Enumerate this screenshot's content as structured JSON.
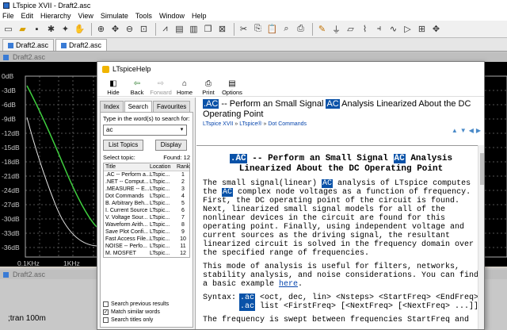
{
  "app": {
    "title": "LTspice XVII - Draft2.asc",
    "menu": [
      "File",
      "Edit",
      "Hierarchy",
      "View",
      "Simulate",
      "Tools",
      "Window",
      "Help"
    ],
    "tabs": [
      "Draft2.asc",
      "Draft2.asc"
    ]
  },
  "plot": {
    "window_title": "Draft2.asc",
    "y_ticks": [
      "0dB",
      "-3dB",
      "-6dB",
      "-9dB",
      "-12dB",
      "-15dB",
      "-18dB",
      "-21dB",
      "-24dB",
      "-27dB",
      "-30dB",
      "-33dB",
      "-36dB"
    ],
    "x_ticks": [
      "0.1KHz",
      "1KHz"
    ]
  },
  "schematic": {
    "window_title": "Draft2.asc",
    "directive": ";tran 100m"
  },
  "help": {
    "window_title": "LTspiceHelp",
    "toolbar": [
      "Hide",
      "Back",
      "Forward",
      "Home",
      "Print",
      "Options"
    ],
    "nav_tabs": [
      "Index",
      "Search",
      "Favourites"
    ],
    "search_label": "Type in the word(s) to search for:",
    "search_value": "ac",
    "list_topics_label": "List Topics",
    "display_label": "Display",
    "select_topic_label": "Select topic:",
    "found_label": "Found: 12",
    "results_headers": [
      "Title",
      "Location",
      "Rank"
    ],
    "results": [
      {
        "title": ".AC -- Perform a...",
        "location": "LTspic...",
        "rank": "1"
      },
      {
        "title": ".NET -- Comput...",
        "location": "LTspic...",
        "rank": "2"
      },
      {
        "title": ".MEASURE -- E...",
        "location": "LTspic...",
        "rank": "3"
      },
      {
        "title": "Dot Commands",
        "location": "LTspic...",
        "rank": "4"
      },
      {
        "title": "B. Arbitrary Beh...",
        "location": "LTspic...",
        "rank": "5"
      },
      {
        "title": "I. Current Source",
        "location": "LTspic...",
        "rank": "6"
      },
      {
        "title": "V. Voltage Sour...",
        "location": "LTspic...",
        "rank": "7"
      },
      {
        "title": "Waveform Arith...",
        "location": "LTspic...",
        "rank": "8"
      },
      {
        "title": "Save Plot Confi...",
        "location": "LTspic...",
        "rank": "9"
      },
      {
        "title": "Fast Access File...",
        "location": "LTspic...",
        "rank": "10"
      },
      {
        "title": "NOISE -- Perfo...",
        "location": "LTspic...",
        "rank": "11"
      },
      {
        "title": "M. MOSFET",
        "location": "LTspic...",
        "rank": "12"
      }
    ],
    "checkboxes": [
      {
        "label": "Search previous results",
        "checked": false
      },
      {
        "label": "Match similar words",
        "checked": true
      },
      {
        "label": "Search titles only",
        "checked": false
      }
    ],
    "topic_title_a": ".AC",
    "topic_title_b": " -- Perform an Small Signal ",
    "topic_title_c": "AC",
    "topic_title_d": " Analysis Linearized About the DC Operating Point",
    "crumb_a": "LTspice XVII",
    "crumb_b": "LTspice®",
    "crumb_c": "Dot Commands",
    "heading_a": ".AC",
    "heading_b": " -- Perform an Small Signal ",
    "heading_c": "AC",
    "heading_d": " Analysis",
    "heading_line2": "Linearized About the DC Operating Point",
    "para1_a": "The small signal(linear) ",
    "para1_b": "AC",
    "para1_c": " analysis of LTspice computes the ",
    "para1_d": "AC",
    "para1_e": " complex node voltages as a function of frequency. First, the DC operating point of the circuit is found. Next, linearized small signal models for all of the nonlinear devices in the circuit are found for this operating point. Finally, using independent voltage and current sources as the driving signal, the resultant linearized circuit is solved in the frequency domain over the specified range of frequencies.",
    "para2": "This mode of analysis is useful for filters, networks, stability analysis, and noise considerations. You can find a basic example ",
    "para2_link": "here",
    "syntax_label": "Syntax:",
    "syntax1_kw": ".ac",
    "syntax1_rest": " <oct, dec, lin> <Nsteps> <StartFreq> <EndFreq>",
    "syntax2_kw": ".ac",
    "syntax2_rest": " list <FirstFreq> [<NextFreq> [<NextFreq> ...]]",
    "para3": "The frequency is swept between frequencies StartFreq and"
  }
}
